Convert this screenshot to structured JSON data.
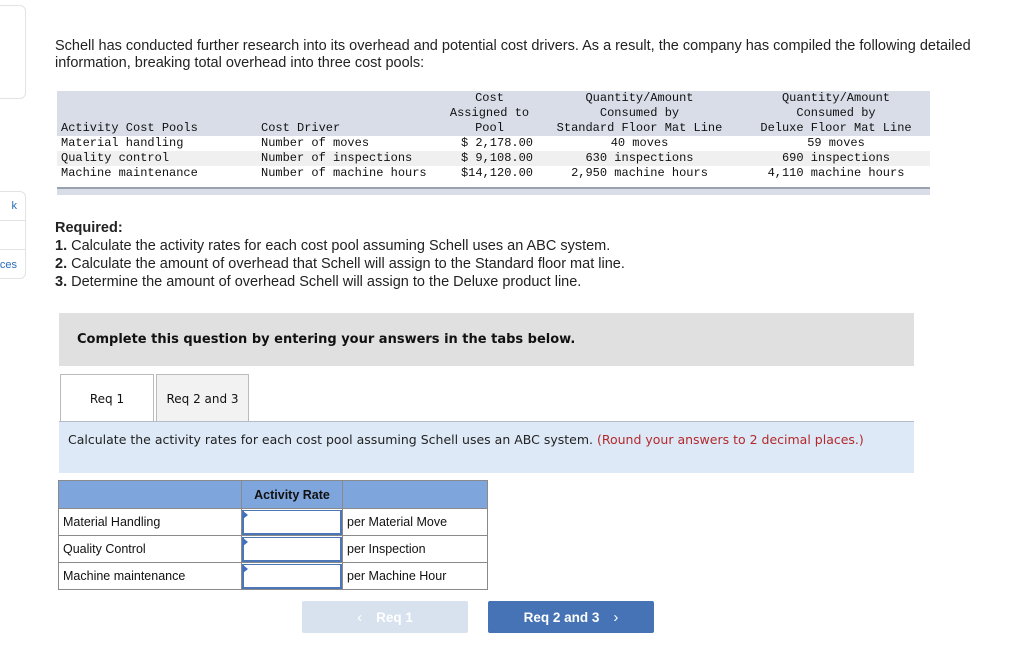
{
  "sidebar": {
    "nav_items": [
      "k",
      "",
      "ces"
    ]
  },
  "intro": {
    "text": "Schell has conducted further research into its overhead and potential cost drivers. As a result, the company has compiled the following detailed information, breaking total overhead into three cost pools:"
  },
  "data_table": {
    "headers": {
      "pool": "Activity Cost Pools",
      "driver": "Cost Driver",
      "cost_line1": "Cost",
      "cost_line2": "Assigned to",
      "cost_line3": "Pool",
      "standard_line1": "Quantity/Amount",
      "standard_line2": "Consumed by",
      "standard_line3": "Standard Floor Mat Line",
      "deluxe_line1": "Quantity/Amount",
      "deluxe_line2": "Consumed by",
      "deluxe_line3": "Deluxe Floor Mat Line"
    },
    "rows": [
      {
        "pool": "Material handling",
        "driver": "Number of moves",
        "cost": "$ 2,178.00",
        "standard": "40 moves",
        "deluxe": "59 moves"
      },
      {
        "pool": "Quality control",
        "driver": "Number of inspections",
        "cost": "$ 9,108.00",
        "standard": "630 inspections",
        "deluxe": "690 inspections"
      },
      {
        "pool": "Machine maintenance",
        "driver": "Number of machine hours",
        "cost": "$14,120.00",
        "standard": "2,950 machine hours",
        "deluxe": "4,110 machine hours"
      }
    ]
  },
  "required": {
    "heading": "Required:",
    "items": [
      {
        "num": "1.",
        "text": " Calculate the activity rates for each cost pool assuming Schell uses an ABC system."
      },
      {
        "num": "2.",
        "text": " Calculate the amount of overhead that Schell will assign to the Standard floor mat line."
      },
      {
        "num": "3.",
        "text": " Determine the amount of overhead Schell will assign to the Deluxe product line."
      }
    ]
  },
  "instruction_banner": "Complete this question by entering your answers in the tabs below.",
  "tabs": [
    {
      "label": "Req 1",
      "active": true
    },
    {
      "label": "Req 2 and 3",
      "active": false
    }
  ],
  "task": {
    "text": "Calculate the activity rates for each cost pool assuming Schell uses an ABC system. ",
    "hint": "(Round your answers to 2 decimal places.)"
  },
  "rate_table": {
    "header": "Activity Rate",
    "rows": [
      {
        "label": "Material Handling",
        "value": "",
        "unit": "per Material Move"
      },
      {
        "label": "Quality Control",
        "value": "",
        "unit": "per Inspection"
      },
      {
        "label": "Machine maintenance",
        "value": "",
        "unit": "per Machine Hour"
      }
    ]
  },
  "navigation": {
    "prev_label": "Req 1",
    "next_label": "Req 2 and 3",
    "prev_icon": "‹",
    "next_icon": "›"
  },
  "colors": {
    "accent": "#4573b5",
    "hint": "#b3292b",
    "table_header": "#7fa6dc"
  }
}
